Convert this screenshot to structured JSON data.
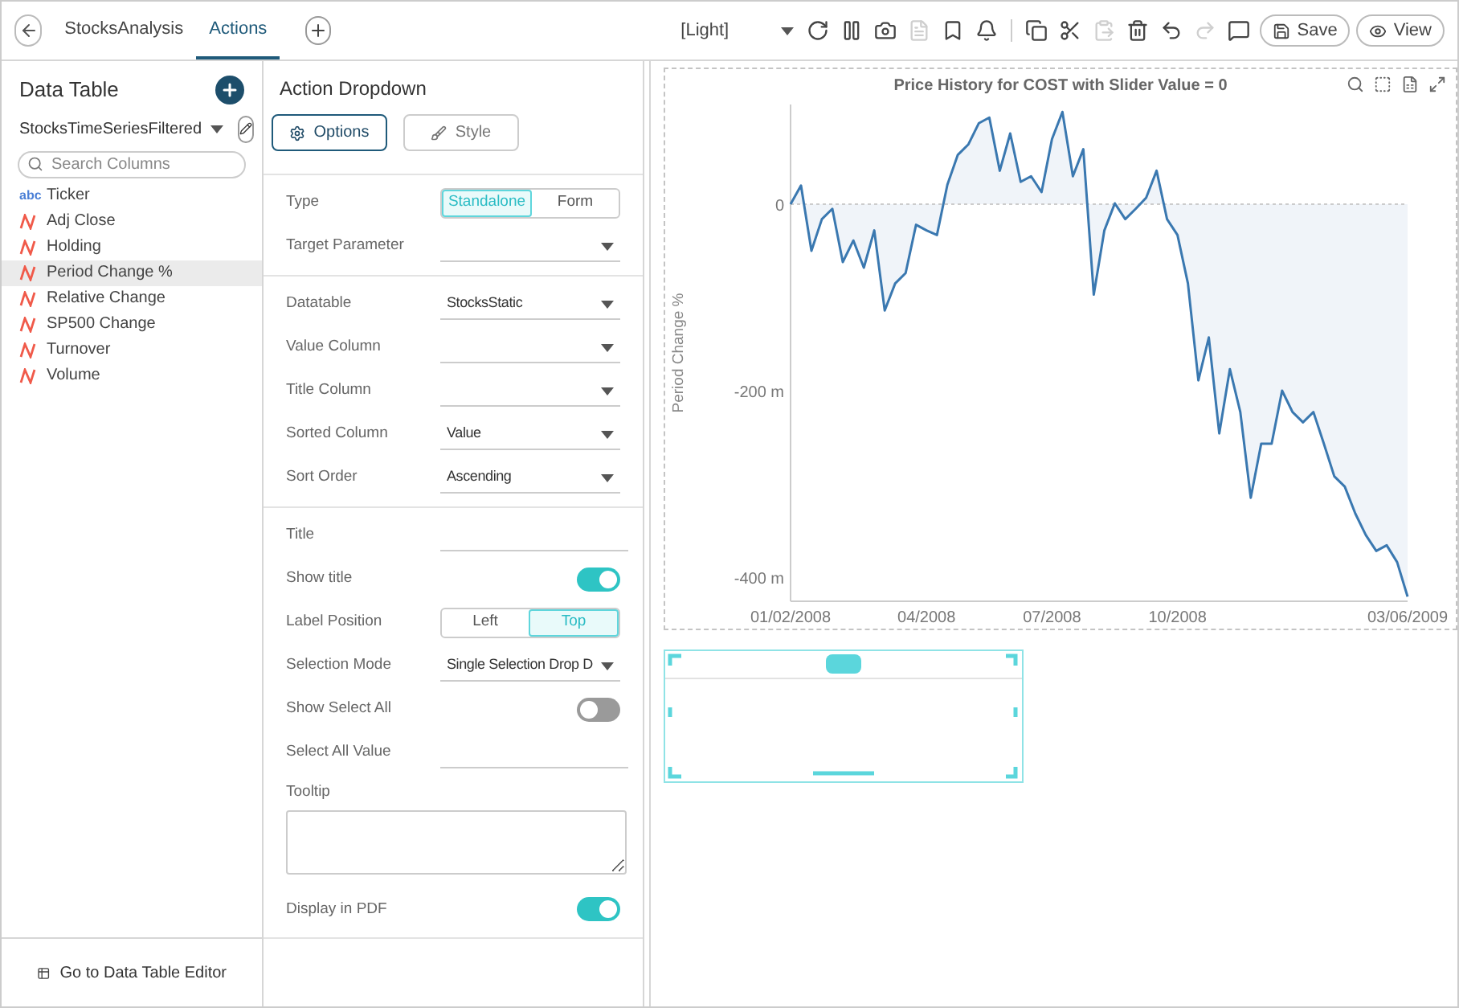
{
  "tabs": [
    {
      "label": "StocksAnalysis",
      "selected": false
    },
    {
      "label": "Actions",
      "selected": true
    }
  ],
  "toolbar": {
    "theme": "[Light]",
    "icon_groups": [
      [
        {
          "kind": "refresh",
          "disabled": false
        },
        {
          "kind": "pause",
          "disabled": false
        },
        {
          "kind": "snapshot",
          "disabled": false
        },
        {
          "kind": "pdf",
          "disabled": true
        },
        {
          "kind": "bookmark",
          "disabled": false
        },
        {
          "kind": "alert",
          "disabled": false
        }
      ],
      [
        {
          "kind": "copy",
          "disabled": false
        },
        {
          "kind": "cut",
          "disabled": false
        },
        {
          "kind": "paste",
          "disabled": true
        },
        {
          "kind": "delete",
          "disabled": false
        },
        {
          "kind": "undo",
          "disabled": false
        },
        {
          "kind": "redo",
          "disabled": true
        },
        {
          "kind": "comment",
          "disabled": false
        }
      ]
    ],
    "save": "Save",
    "view": "View"
  },
  "data_table": {
    "title": "Data Table",
    "source": "StocksTimeSeriesFiltered",
    "search": {
      "placeholder": "Search Columns"
    },
    "columns": [
      {
        "name": "Ticker",
        "kind": "text",
        "badge": "abc",
        "selected": false
      },
      {
        "name": "Adj Close",
        "kind": "numeric",
        "selected": false
      },
      {
        "name": "Holding",
        "kind": "numeric",
        "selected": false
      },
      {
        "name": "Period Change %",
        "kind": "numeric",
        "selected": true
      },
      {
        "name": "Relative Change",
        "kind": "numeric",
        "selected": false
      },
      {
        "name": "SP500 Change",
        "kind": "numeric",
        "selected": false
      },
      {
        "name": "Turnover",
        "kind": "numeric",
        "selected": false
      },
      {
        "name": "Volume",
        "kind": "numeric",
        "selected": false
      }
    ],
    "footer": "Go to Data Table Editor"
  },
  "settings": {
    "title": "Action Dropdown",
    "tabs": [
      {
        "label": "Options",
        "selected": true
      },
      {
        "label": "Style",
        "selected": false
      }
    ],
    "sections": [
      {
        "rows": [
          {
            "kind": "segmented",
            "label": "Type",
            "options": [
              {
                "label": "Standalone",
                "selected": true
              },
              {
                "label": "Form",
                "selected": false
              }
            ]
          },
          {
            "kind": "select",
            "label": "Target Parameter"
          }
        ]
      },
      {
        "rows": [
          {
            "kind": "select",
            "label": "Datatable",
            "value": "StocksStatic"
          },
          {
            "kind": "select",
            "label": "Value Column"
          },
          {
            "kind": "select",
            "label": "Title Column"
          },
          {
            "kind": "select",
            "label": "Sorted Column",
            "value": "Value"
          },
          {
            "kind": "select",
            "label": "Sort Order",
            "value": "Ascending"
          }
        ]
      },
      {
        "rows": [
          {
            "kind": "input",
            "label": "Title"
          },
          {
            "kind": "toggle",
            "label": "Show title",
            "on": true
          },
          {
            "kind": "segmented",
            "label": "Label Position",
            "options": [
              {
                "label": "Left",
                "selected": false
              },
              {
                "label": "Top",
                "selected": true
              }
            ]
          },
          {
            "kind": "select",
            "label": "Selection Mode",
            "value": "Single Selection Drop D"
          },
          {
            "kind": "toggle",
            "label": "Show Select All",
            "on": false
          },
          {
            "kind": "input",
            "label": "Select All Value"
          },
          {
            "kind": "textarea",
            "label": "Tooltip"
          },
          {
            "kind": "toggle",
            "label": "Display in PDF",
            "on": true
          }
        ]
      }
    ]
  },
  "chart": {
    "title": "Price History for COST with Slider Value = 0",
    "chart_data": {
      "type": "line",
      "ylabel": "Period Change %",
      "ylim": [
        -426,
        107
      ],
      "yticks": [
        {
          "value": 0,
          "label": "0"
        },
        {
          "value": -200,
          "label": "-200 m"
        },
        {
          "value": -400,
          "label": "-400 m"
        }
      ],
      "categories": [
        "01/02/2008",
        null,
        null,
        null,
        null,
        null,
        null,
        null,
        null,
        null,
        null,
        null,
        null,
        "04/2008",
        null,
        null,
        null,
        null,
        null,
        null,
        null,
        null,
        null,
        null,
        null,
        "07/2008",
        null,
        null,
        null,
        null,
        null,
        null,
        null,
        null,
        null,
        null,
        null,
        "10/2008",
        null,
        null,
        null,
        null,
        null,
        null,
        null,
        null,
        null,
        null,
        null,
        null,
        null,
        null,
        null,
        null,
        null,
        null,
        null,
        null,
        null,
        "03/06/2009"
      ],
      "series": [
        {
          "color": "#3a78b0",
          "values": [
            0,
            20,
            -50,
            -16,
            -5,
            -62,
            -39,
            -68,
            -28,
            -114,
            -85,
            -74,
            -22,
            -28,
            -33,
            21,
            53,
            64,
            87,
            93,
            36,
            76,
            24,
            30,
            13,
            70,
            99,
            30,
            59,
            -97,
            -28,
            1,
            -16,
            -5,
            7,
            36,
            -16,
            -33,
            -85,
            -189,
            -143,
            -246,
            -177,
            -223,
            -315,
            -257,
            -257,
            -200,
            -223,
            -234,
            -223,
            -257,
            -292,
            -303,
            -332,
            -355,
            -372,
            -366,
            -384,
            -421
          ]
        }
      ]
    }
  }
}
